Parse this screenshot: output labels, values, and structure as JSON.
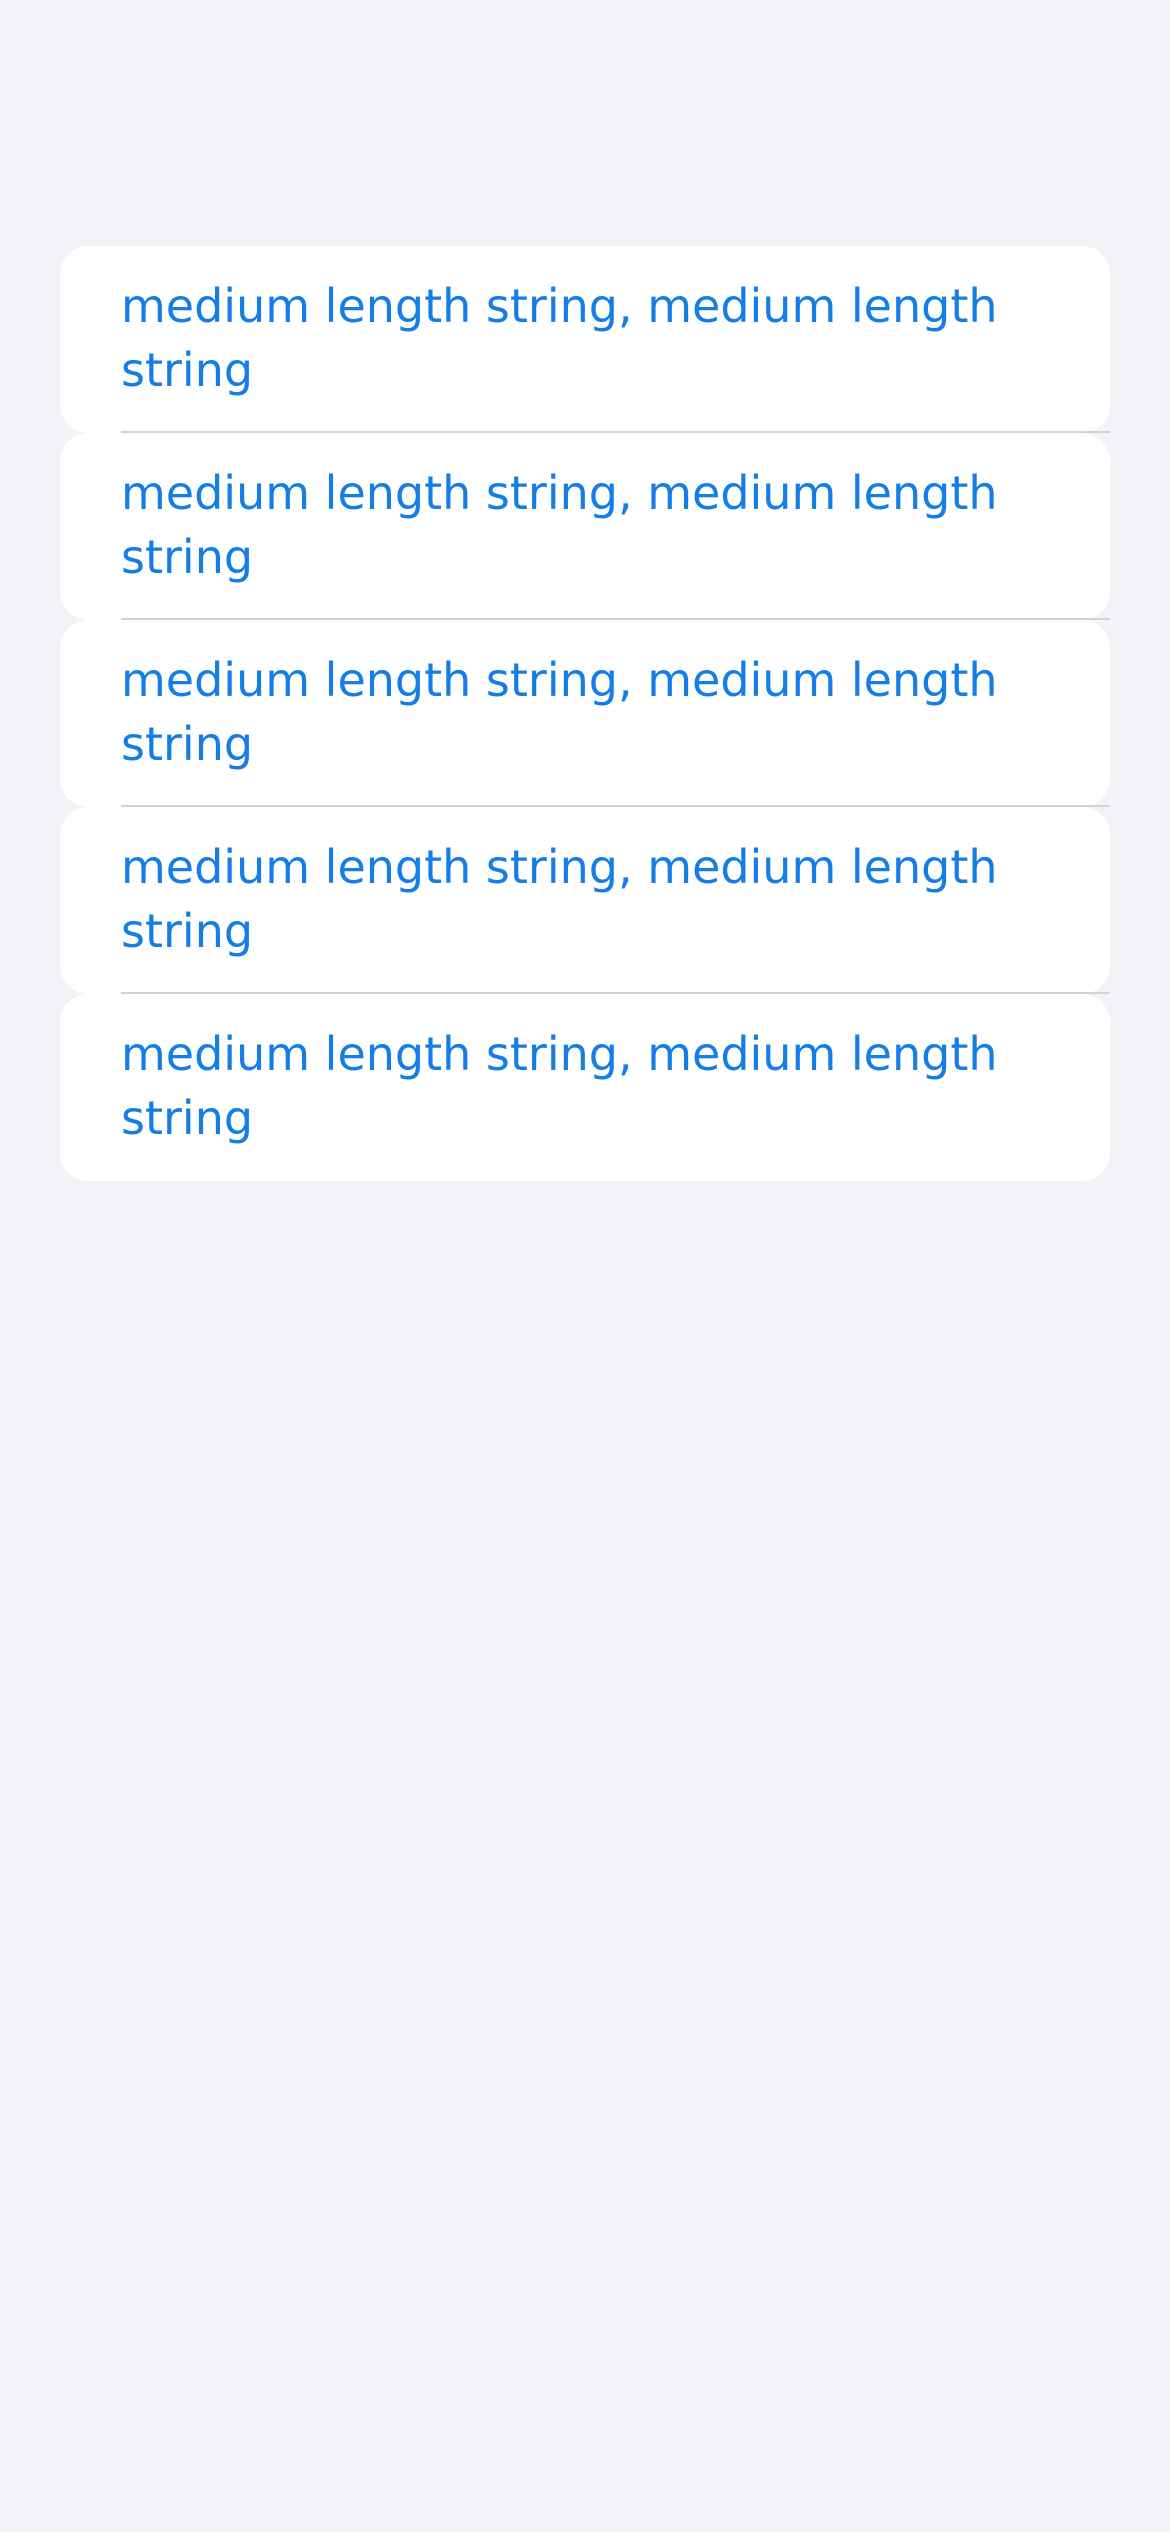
{
  "list": {
    "items": [
      {
        "label": "medium length string, medium length string"
      },
      {
        "label": "medium length string, medium length string"
      },
      {
        "label": "medium length string, medium length string"
      },
      {
        "label": "medium length string, medium length string"
      },
      {
        "label": "medium length string, medium length string"
      }
    ]
  },
  "colors": {
    "background": "#f2f2f7",
    "cell_background": "#ffffff",
    "link_text": "#147ee6",
    "separator": "#d1d1d6"
  }
}
